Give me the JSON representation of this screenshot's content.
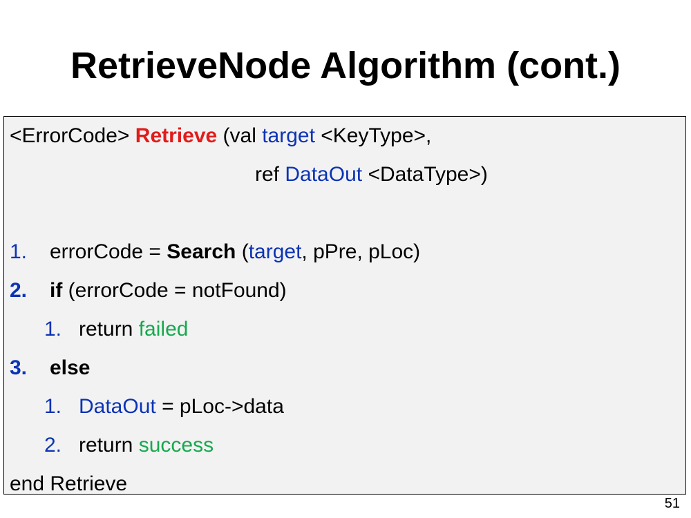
{
  "slide": {
    "title": "RetrieveNode Algorithm (cont.)",
    "page_number": "51"
  },
  "code": {
    "signature_line1": {
      "return_type": "<ErrorCode>",
      "function_name": "Retrieve",
      "param1_prefix": "(val",
      "param1_name": "target",
      "param1_type": "<KeyType>,"
    },
    "signature_line2": {
      "param2_prefix": "ref",
      "param2_name": "DataOut",
      "param2_type": "<DataType>)"
    },
    "step1": {
      "number": "1.",
      "lhs": "errorCode =",
      "call": "Search",
      "open": "(",
      "arg1": "target",
      "rest": ", pPre, pLoc)"
    },
    "step2": {
      "number": "2.",
      "keyword": "if",
      "condition": "(errorCode = notFound)"
    },
    "step2_1": {
      "number": "1.",
      "text": "return",
      "value": "failed"
    },
    "step3": {
      "number": "3.",
      "keyword": "else"
    },
    "step3_1": {
      "number": "1.",
      "target": "DataOut",
      "assign": "= pLoc->data"
    },
    "step3_2": {
      "number": "2.",
      "text": "return",
      "value": "success"
    },
    "end_line": "end Retrieve"
  },
  "colors": {
    "function_name": "#e21b1b",
    "identifier": "#0b33b5",
    "status_value": "#18a84f",
    "code_background": "#f2f2f2"
  }
}
